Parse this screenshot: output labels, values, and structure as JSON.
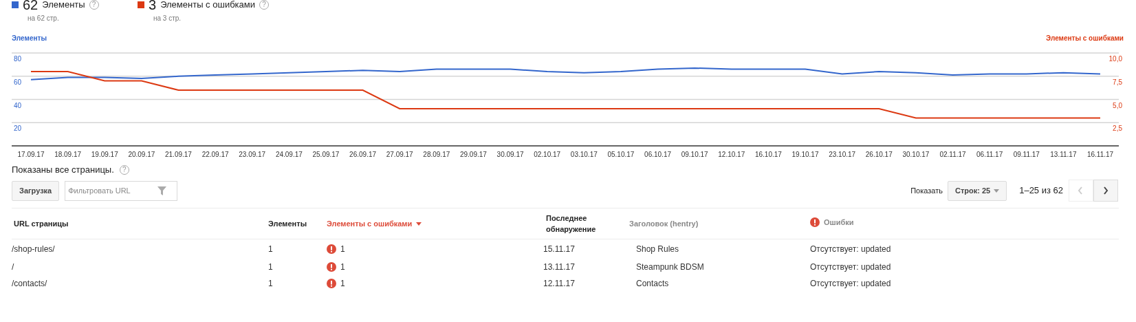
{
  "legend": [
    {
      "count": "62",
      "label": "Элементы",
      "help": "?",
      "sub": "на 62 стр.",
      "color": "#3366cc"
    },
    {
      "count": "3",
      "label": "Элементы с ошибками",
      "help": "?",
      "sub": "на 3 стр.",
      "color": "#dc3912"
    }
  ],
  "chart": {
    "chart_data": {
      "type": "line",
      "grid": true,
      "categories": [
        "17.09.17",
        "18.09.17",
        "19.09.17",
        "20.09.17",
        "21.09.17",
        "22.09.17",
        "23.09.17",
        "24.09.17",
        "25.09.17",
        "26.09.17",
        "27.09.17",
        "28.09.17",
        "29.09.17",
        "30.09.17",
        "02.10.17",
        "03.10.17",
        "05.10.17",
        "06.10.17",
        "09.10.17",
        "12.10.17",
        "16.10.17",
        "19.10.17",
        "23.10.17",
        "26.10.17",
        "30.10.17",
        "02.11.17",
        "06.11.17",
        "09.11.17",
        "13.11.17",
        "16.11.17"
      ],
      "series": [
        {
          "name": "Элементы",
          "color": "#3366cc",
          "axis": "y",
          "values": [
            57,
            59,
            59,
            58,
            60,
            61,
            62,
            63,
            64,
            65,
            64,
            66,
            66,
            66,
            64,
            63,
            64,
            66,
            67,
            66,
            66,
            66,
            62,
            64,
            63,
            61,
            62,
            62,
            63,
            62
          ]
        },
        {
          "name": "Элементы с ошибками",
          "color": "#dc3912",
          "axis": "y2",
          "values": [
            8,
            8,
            7,
            7,
            6,
            6,
            6,
            6,
            6,
            6,
            4,
            4,
            4,
            4,
            4,
            4,
            4,
            4,
            4,
            4,
            4,
            4,
            4,
            4,
            3,
            3,
            3,
            3,
            3,
            3
          ]
        }
      ],
      "ylim": [
        0,
        80
      ],
      "yticks": [
        20,
        40,
        60,
        80
      ],
      "y2lim": [
        0,
        10
      ],
      "y2ticks": [
        {
          "value": 2.5,
          "label": "2,5"
        },
        {
          "value": 5,
          "label": "5,0"
        },
        {
          "value": 7.5,
          "label": "7,5"
        },
        {
          "value": 10,
          "label": "10,0"
        }
      ]
    }
  },
  "status": {
    "text": "Показаны все страницы.",
    "help": "?"
  },
  "toolbar": {
    "download_button": "Загрузка",
    "filter": {
      "placeholder": "Фильтровать URL"
    },
    "show_label": "Показать",
    "rows_select": "Строк: 25",
    "range": "1–25 из 62",
    "prev": {
      "disabled": true
    },
    "next": {
      "disabled": false
    }
  },
  "table": {
    "columns": [
      {
        "label": "URL страницы",
        "kind": "main",
        "sorted": false
      },
      {
        "label": "Элементы",
        "kind": "main",
        "sorted": false
      },
      {
        "label": "Элементы с ошибками",
        "kind": "main",
        "sorted": true
      },
      {
        "label": "Последнее обнаружение",
        "kind": "main",
        "sorted": false
      },
      {
        "label": "Заголовок (hentry)",
        "kind": "property",
        "sorted": false
      },
      {
        "label": "Ошибки",
        "kind": "error",
        "sorted": false
      }
    ],
    "rows": [
      {
        "url": "/shop-rules/",
        "elements": "1",
        "errors": "1",
        "last_seen": "15.11.17",
        "title": "Shop Rules",
        "error_text": "Отсутствует: updated"
      },
      {
        "url": "/",
        "elements": "1",
        "errors": "1",
        "last_seen": "13.11.17",
        "title": "Steampunk BDSM",
        "error_text": "Отсутствует: updated"
      },
      {
        "url": "/contacts/",
        "elements": "1",
        "errors": "1",
        "last_seen": "12.11.17",
        "title": "Contacts",
        "error_text": "Отсутствует: updated"
      }
    ]
  }
}
